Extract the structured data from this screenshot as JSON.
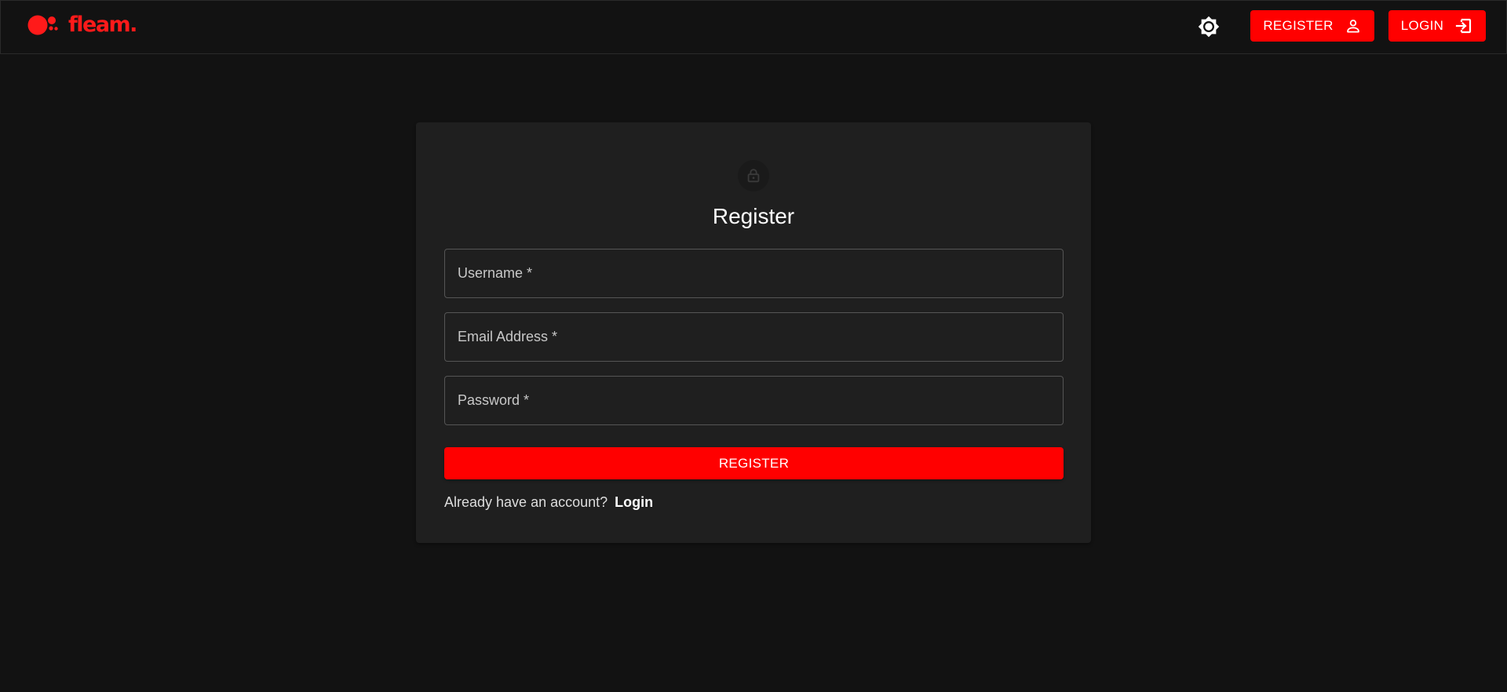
{
  "brand": {
    "name": "fleam.",
    "accent_color": "#ff0000"
  },
  "header": {
    "theme_toggle_icon": "brightness-icon",
    "register_button": {
      "label": "REGISTER",
      "icon": "person-icon"
    },
    "login_button": {
      "label": "LOGIN",
      "icon": "login-arrow-icon"
    }
  },
  "register_form": {
    "icon": "lock-icon",
    "title": "Register",
    "fields": {
      "username": {
        "placeholder": "Username *",
        "value": ""
      },
      "email": {
        "placeholder": "Email Address *",
        "value": ""
      },
      "password": {
        "placeholder": "Password *",
        "value": ""
      }
    },
    "submit_label": "REGISTER",
    "footer_text": "Already have an account?",
    "footer_link": "Login"
  }
}
